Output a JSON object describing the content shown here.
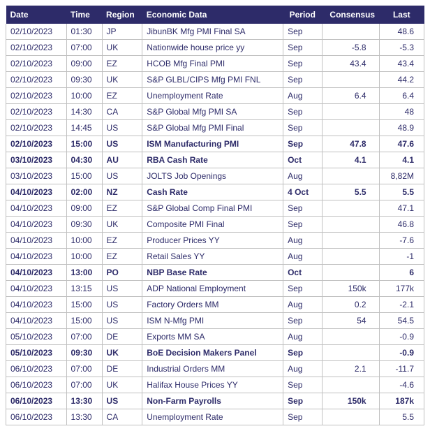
{
  "headers": {
    "date": "Date",
    "time": "Time",
    "region": "Region",
    "data": "Economic Data",
    "period": "Period",
    "consensus": "Consensus",
    "last": "Last"
  },
  "rows": [
    {
      "date": "02/10/2023",
      "time": "01:30",
      "region": "JP",
      "data": "JibunBK Mfg PMI Final SA",
      "period": "Sep",
      "consensus": "",
      "last": "48.6",
      "bold": false,
      "daybreak": false
    },
    {
      "date": "02/10/2023",
      "time": "07:00",
      "region": "UK",
      "data": "Nationwide house price yy",
      "period": "Sep",
      "consensus": "-5.8",
      "last": "-5.3",
      "bold": false,
      "daybreak": false
    },
    {
      "date": "02/10/2023",
      "time": "09:00",
      "region": "EZ",
      "data": "HCOB Mfg Final PMI",
      "period": "Sep",
      "consensus": "43.4",
      "last": "43.4",
      "bold": false,
      "daybreak": false
    },
    {
      "date": "02/10/2023",
      "time": "09:30",
      "region": "UK",
      "data": "S&P GLBL/CIPS Mfg PMI FNL",
      "period": "Sep",
      "consensus": "",
      "last": "44.2",
      "bold": false,
      "daybreak": false
    },
    {
      "date": "02/10/2023",
      "time": "10:00",
      "region": "EZ",
      "data": "Unemployment Rate",
      "period": "Aug",
      "consensus": "6.4",
      "last": "6.4",
      "bold": false,
      "daybreak": false
    },
    {
      "date": "02/10/2023",
      "time": "14:30",
      "region": "CA",
      "data": "S&P Global Mfg PMI SA",
      "period": "Sep",
      "consensus": "",
      "last": "48",
      "bold": false,
      "daybreak": false
    },
    {
      "date": "02/10/2023",
      "time": "14:45",
      "region": "US",
      "data": "S&P Global Mfg PMI Final",
      "period": "Sep",
      "consensus": "",
      "last": "48.9",
      "bold": false,
      "daybreak": false
    },
    {
      "date": "02/10/2023",
      "time": "15:00",
      "region": "US",
      "data": "ISM Manufacturing PMI",
      "period": "Sep",
      "consensus": "47.8",
      "last": "47.6",
      "bold": true,
      "daybreak": false
    },
    {
      "date": "03/10/2023",
      "time": "04:30",
      "region": "AU",
      "data": "RBA Cash Rate",
      "period": "Oct",
      "consensus": "4.1",
      "last": "4.1",
      "bold": true,
      "daybreak": true
    },
    {
      "date": "03/10/2023",
      "time": "15:00",
      "region": "US",
      "data": "JOLTS Job Openings",
      "period": "Aug",
      "consensus": "",
      "last": "8,82M",
      "bold": false,
      "daybreak": false
    },
    {
      "date": "04/10/2023",
      "time": "02:00",
      "region": "NZ",
      "data": "Cash Rate",
      "period": "4 Oct",
      "consensus": "5.5",
      "last": "5.5",
      "bold": true,
      "daybreak": true
    },
    {
      "date": "04/10/2023",
      "time": "09:00",
      "region": "EZ",
      "data": "S&P Global Comp Final PMI",
      "period": "Sep",
      "consensus": "",
      "last": "47.1",
      "bold": false,
      "daybreak": false
    },
    {
      "date": "04/10/2023",
      "time": "09:30",
      "region": "UK",
      "data": "Composite PMI Final",
      "period": "Sep",
      "consensus": "",
      "last": "46.8",
      "bold": false,
      "daybreak": false
    },
    {
      "date": "04/10/2023",
      "time": "10:00",
      "region": "EZ",
      "data": "Producer Prices YY",
      "period": "Aug",
      "consensus": "",
      "last": "-7.6",
      "bold": false,
      "daybreak": false
    },
    {
      "date": "04/10/2023",
      "time": "10:00",
      "region": "EZ",
      "data": "Retail Sales YY",
      "period": "Aug",
      "consensus": "",
      "last": "-1",
      "bold": false,
      "daybreak": false
    },
    {
      "date": "04/10/2023",
      "time": "13:00",
      "region": "PO",
      "data": "NBP Base Rate",
      "period": "Oct",
      "consensus": "",
      "last": "6",
      "bold": true,
      "daybreak": false
    },
    {
      "date": "04/10/2023",
      "time": "13:15",
      "region": "US",
      "data": "ADP National Employment",
      "period": "Sep",
      "consensus": "150k",
      "last": "177k",
      "bold": false,
      "daybreak": false
    },
    {
      "date": "04/10/2023",
      "time": "15:00",
      "region": "US",
      "data": "Factory Orders MM",
      "period": "Aug",
      "consensus": "0.2",
      "last": "-2.1",
      "bold": false,
      "daybreak": false
    },
    {
      "date": "04/10/2023",
      "time": "15:00",
      "region": "US",
      "data": "ISM N-Mfg PMI",
      "period": "Sep",
      "consensus": "54",
      "last": "54.5",
      "bold": false,
      "daybreak": false
    },
    {
      "date": "05/10/2023",
      "time": "07:00",
      "region": "DE",
      "data": "Exports MM SA",
      "period": "Aug",
      "consensus": "",
      "last": "-0.9",
      "bold": false,
      "daybreak": true
    },
    {
      "date": "05/10/2023",
      "time": "09:30",
      "region": "UK",
      "data": "BoE Decision Makers Panel",
      "period": "Sep",
      "consensus": "",
      "last": "-0.9",
      "bold": true,
      "daybreak": false
    },
    {
      "date": "06/10/2023",
      "time": "07:00",
      "region": "DE",
      "data": "Industrial Orders MM",
      "period": "Aug",
      "consensus": "2.1",
      "last": "-11.7",
      "bold": false,
      "daybreak": true
    },
    {
      "date": "06/10/2023",
      "time": "07:00",
      "region": "UK",
      "data": "Halifax House Prices YY",
      "period": "Sep",
      "consensus": "",
      "last": "-4.6",
      "bold": false,
      "daybreak": false
    },
    {
      "date": "06/10/2023",
      "time": "13:30",
      "region": "US",
      "data": "Non-Farm Payrolls",
      "period": "Sep",
      "consensus": "150k",
      "last": "187k",
      "bold": true,
      "daybreak": false
    },
    {
      "date": "06/10/2023",
      "time": "13:30",
      "region": "CA",
      "data": "Unemployment Rate",
      "period": "Sep",
      "consensus": "",
      "last": "5.5",
      "bold": false,
      "daybreak": false
    }
  ]
}
